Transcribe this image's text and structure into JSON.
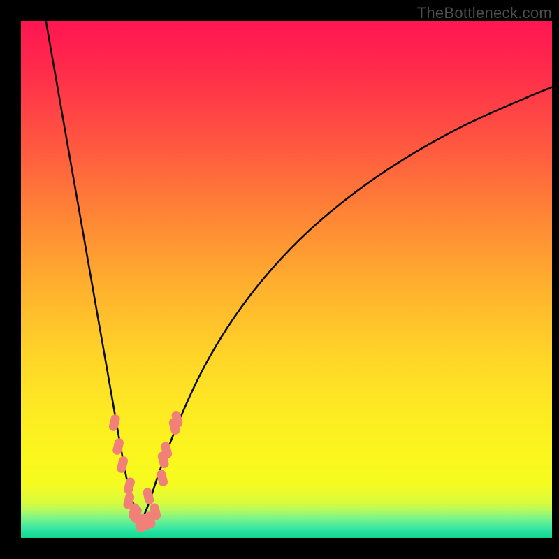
{
  "watermark": "TheBottleneck.com",
  "colors": {
    "curve_stroke": "#0d0d0d",
    "marker_fill": "#f08078",
    "marker_stroke": "#e36a62",
    "frame": "#000000"
  },
  "chart_data": {
    "type": "line",
    "title": "",
    "xlabel": "",
    "ylabel": "",
    "xlim": [
      0,
      100
    ],
    "ylim": [
      0,
      100
    ],
    "note": "No numeric axis ticks are visible; values are estimated from pixel positions on a 0–100 normalized scale. Two curved lines descend from top edges toward a common minimum near x≈22, y≈2, forming a V. Light-salmon rounded markers are clustered along both curves near the bottom.",
    "series": [
      {
        "name": "left-curve",
        "x": [
          4.7,
          7.0,
          9.3,
          11.6,
          13.9,
          16.2,
          18.5,
          19.9,
          21.2,
          22.4
        ],
        "y": [
          100.0,
          86.5,
          73.0,
          59.6,
          46.1,
          32.7,
          19.2,
          11.5,
          6.5,
          2.7
        ]
      },
      {
        "name": "right-curve",
        "x": [
          22.4,
          24.0,
          26.3,
          29.9,
          34.5,
          40.1,
          46.7,
          54.3,
          63.0,
          72.6,
          83.3,
          95.0,
          100.0
        ],
        "y": [
          2.7,
          6.5,
          13.5,
          23.0,
          33.1,
          42.6,
          51.4,
          59.5,
          66.9,
          73.6,
          79.7,
          85.1,
          87.2
        ]
      }
    ],
    "markers": [
      {
        "series": "left-curve",
        "x": 17.6,
        "y": 22.3
      },
      {
        "series": "left-curve",
        "x": 18.3,
        "y": 17.7
      },
      {
        "series": "left-curve",
        "x": 19.1,
        "y": 14.2
      },
      {
        "series": "left-curve",
        "x": 20.3,
        "y": 7.2
      },
      {
        "series": "left-curve",
        "x": 20.4,
        "y": 10.1
      },
      {
        "series": "left-curve",
        "x": 21.7,
        "y": 4.6
      },
      {
        "series": "left-curve",
        "x": 21.3,
        "y": 5.1
      },
      {
        "series": "right-curve",
        "x": 22.4,
        "y": 2.7
      },
      {
        "series": "right-curve",
        "x": 23.3,
        "y": 3.1
      },
      {
        "series": "right-curve",
        "x": 24.3,
        "y": 3.5
      },
      {
        "series": "right-curve",
        "x": 25.3,
        "y": 5.1
      },
      {
        "series": "right-curve",
        "x": 24.0,
        "y": 8.1
      },
      {
        "series": "right-curve",
        "x": 26.6,
        "y": 11.6
      },
      {
        "series": "right-curve",
        "x": 26.8,
        "y": 15.1
      },
      {
        "series": "right-curve",
        "x": 27.4,
        "y": 17.0
      },
      {
        "series": "right-curve",
        "x": 28.9,
        "y": 21.6
      },
      {
        "series": "right-curve",
        "x": 29.4,
        "y": 23.0
      }
    ]
  }
}
